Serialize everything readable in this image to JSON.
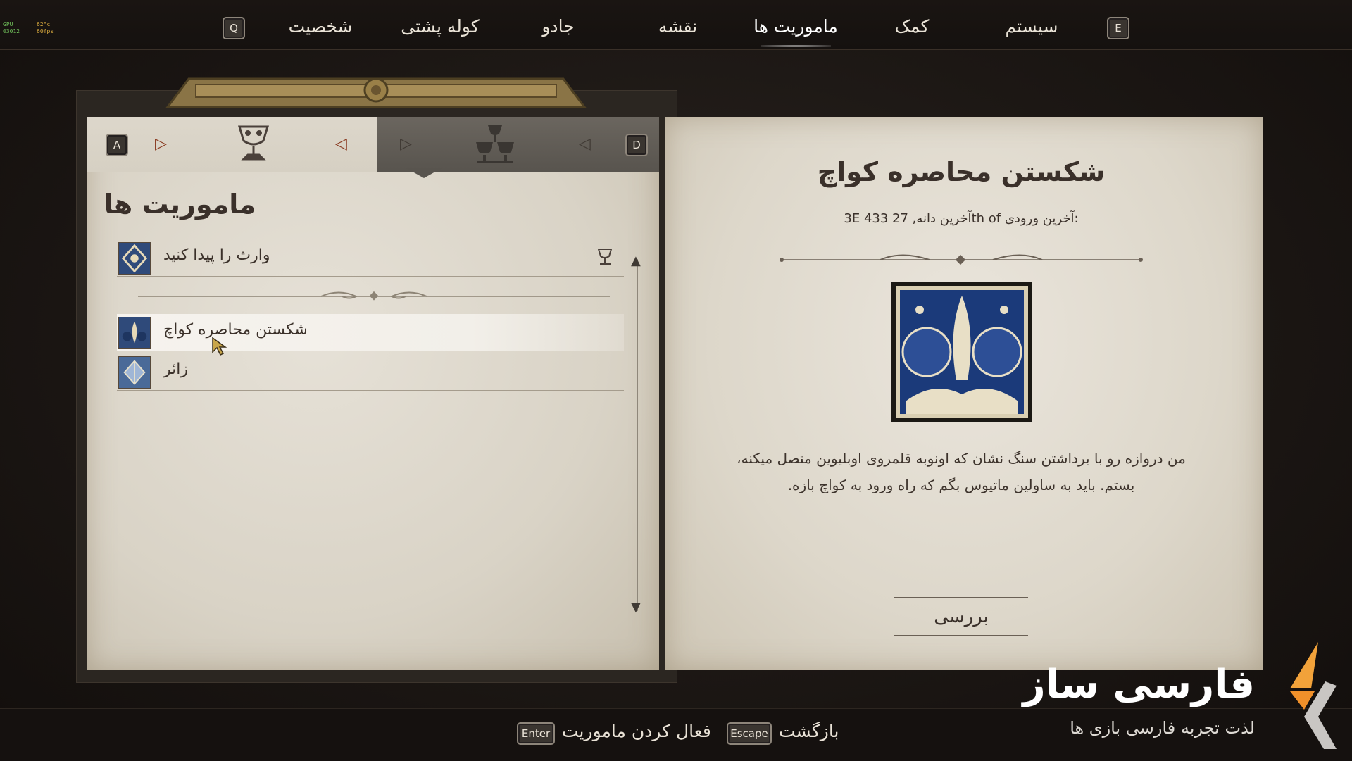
{
  "perf": {
    "gpu_label": "GPU",
    "gpu_value": "03012",
    "temp": "62°c",
    "fps": "60fps"
  },
  "nav": {
    "left_key": "Q",
    "right_key": "E",
    "items": [
      "شخصیت",
      "کوله پشتی",
      "جادو",
      "نقشه",
      "ماموریت ها",
      "کمک",
      "سیستم"
    ],
    "active_index": 4
  },
  "quest_log": {
    "tab_left_key": "A",
    "tab_right_key": "D",
    "title": "ماموریت ها",
    "quests": [
      {
        "label": "وارث را پیدا کنید",
        "icon": "quest-emblem-icon"
      },
      {
        "label": "شکستن محاصره کواچ",
        "icon": "quest-emblem-icon",
        "selected": true
      },
      {
        "label": "زائر",
        "icon": "quest-emblem-icon"
      }
    ]
  },
  "detail": {
    "title": "شکستن محاصره کواچ",
    "date": "3E 433 آخرین دانه, 27th of      آخرین ورودی:",
    "description": "من دروازه رو با برداشتن سنگ نشان که اونوبه قلمروی اوبلیوین متصل میکنه، بستم. باید به ساولین ماتیوس بگم که راه ورود به کواچ بازه.",
    "track_button": "بررسی"
  },
  "bottom": {
    "enter_key": "Enter",
    "enter_label": "فعال کردن ماموریت",
    "escape_key": "Escape",
    "escape_label": "بازگشت"
  },
  "watermark": {
    "brand": "فارسی ساز",
    "tagline": "لذت تجربه فارسی بازی ها"
  },
  "colors": {
    "accent": "#8a3a20",
    "parchment": "#dcd6c9",
    "dark_bg": "#1c1714"
  }
}
